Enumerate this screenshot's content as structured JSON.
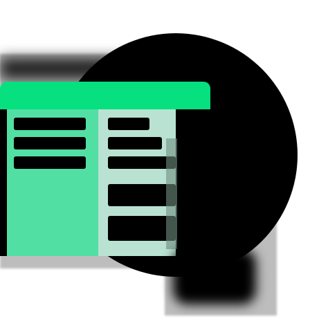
{
  "icon": {
    "name": "app-window-icon",
    "colors": {
      "accent": "#06e07f",
      "pane_left": "#52dfa4",
      "pane_right": "#b9e2d3",
      "dark": "#000000",
      "shadow": "#bdbdbd"
    },
    "left_list_items": 3,
    "right_list_items": 5
  }
}
